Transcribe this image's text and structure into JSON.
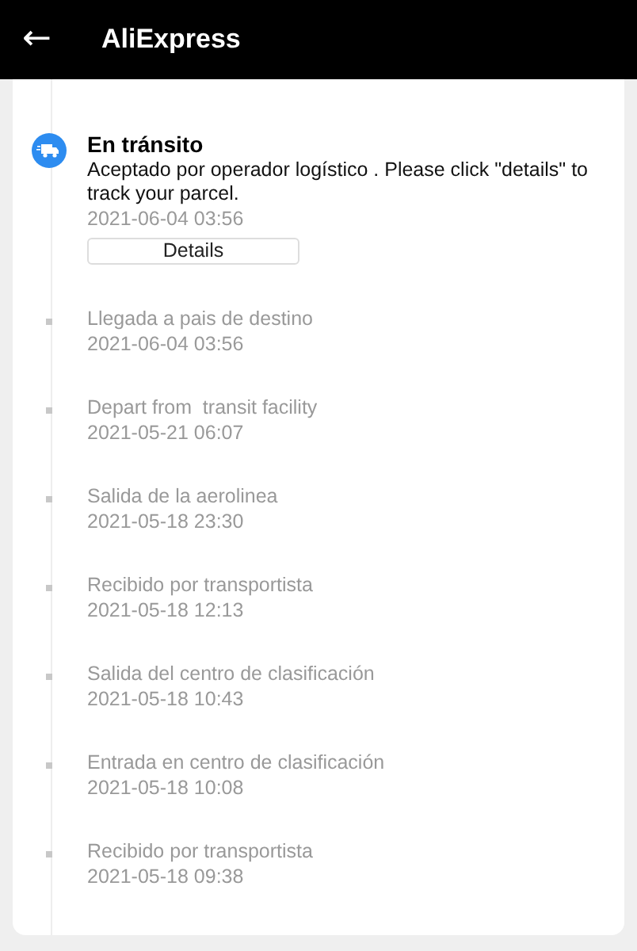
{
  "app_bar": {
    "back": "←",
    "title": "AliExpress"
  },
  "events": [
    {
      "kind": "current",
      "title": "En tránsito",
      "description": "Aceptado por operador logístico . Please click \"details\" to track your parcel.",
      "time": "2021-06-04 03:56",
      "button": "Details"
    },
    {
      "kind": "past",
      "title": "Llegada a pais de destino",
      "time": "2021-06-04 03:56"
    },
    {
      "kind": "past",
      "title": "Depart from  transit facility",
      "time": "2021-05-21 06:07"
    },
    {
      "kind": "past",
      "title": "Salida de la aerolinea",
      "time": "2021-05-18 23:30"
    },
    {
      "kind": "past",
      "title": "Recibido por transportista",
      "time": "2021-05-18 12:13"
    },
    {
      "kind": "past",
      "title": "Salida del centro de clasificación",
      "time": "2021-05-18 10:43"
    },
    {
      "kind": "past",
      "title": "Entrada en centro de clasificación",
      "time": "2021-05-18 10:08"
    },
    {
      "kind": "past",
      "title": "Recibido por transportista",
      "time": "2021-05-18 09:38"
    }
  ]
}
